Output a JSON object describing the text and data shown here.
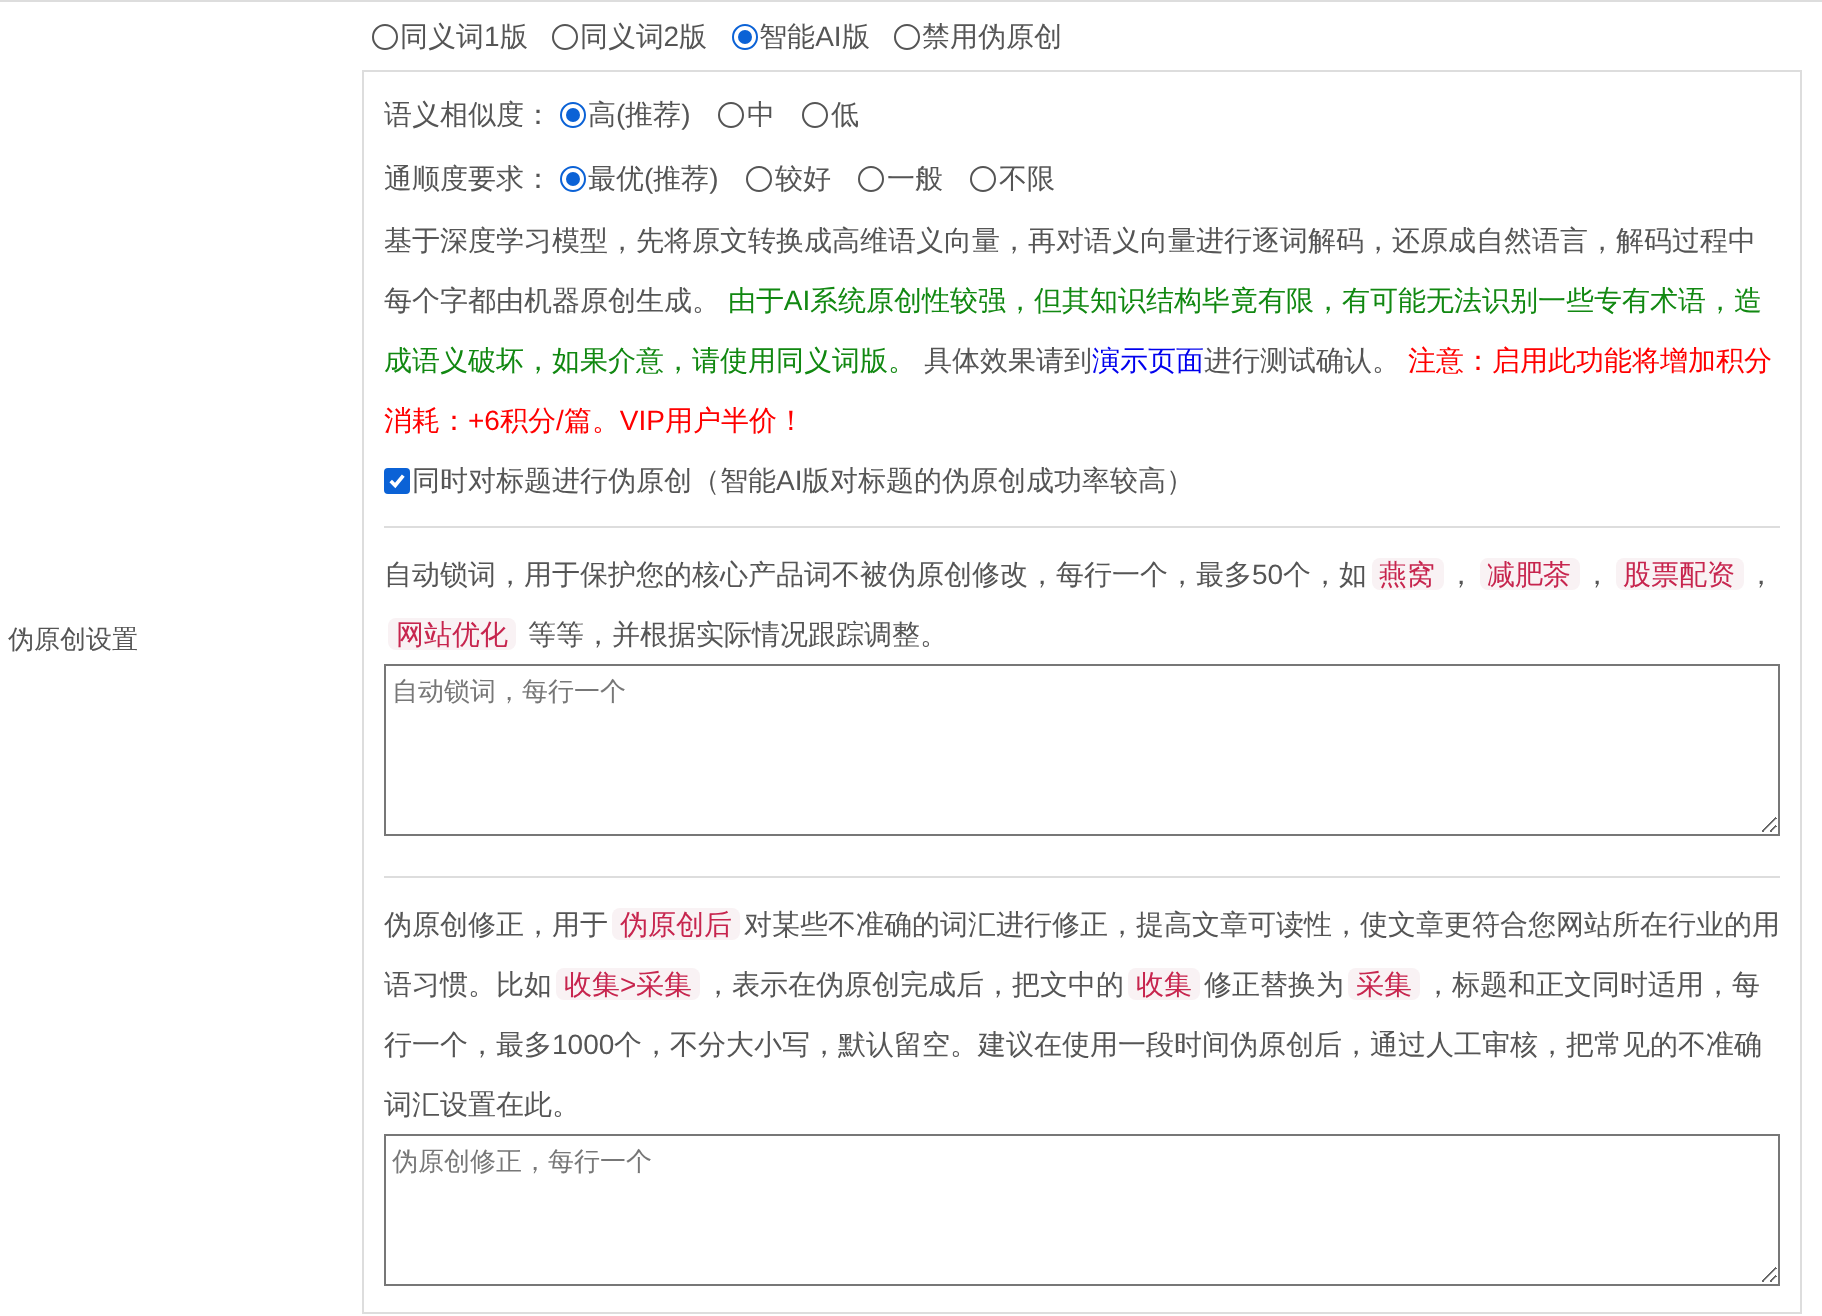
{
  "row_label": "伪原创设置",
  "modes": [
    {
      "label": "同义词1版",
      "selected": false
    },
    {
      "label": "同义词2版",
      "selected": false
    },
    {
      "label": "智能AI版",
      "selected": true
    },
    {
      "label": "禁用伪原创",
      "selected": false
    }
  ],
  "ai_options": [
    {
      "label": "语义相似度：",
      "options": [
        {
          "label": "高(推荐)",
          "selected": true
        },
        {
          "label": "中",
          "selected": false
        },
        {
          "label": "低",
          "selected": false
        }
      ]
    },
    {
      "label": "通顺度要求：",
      "options": [
        {
          "label": "最优(推荐)",
          "selected": true
        },
        {
          "label": "较好",
          "selected": false
        },
        {
          "label": "一般",
          "selected": false
        },
        {
          "label": "不限",
          "selected": false
        }
      ]
    }
  ],
  "ai_description": [
    {
      "kind": "text",
      "text": "基于深度学习模型，先将原文转换成高维语义向量，再对语义向量进行逐词解码，还原成自然语言，解码过程中每个字都由机器原创生成。 "
    },
    {
      "kind": "green",
      "text": "由于AI系统原创性较强，但其知识结构毕竟有限，有可能无法识别一些专有术语，造成语义破坏，如果介意，请使用同义词版。"
    },
    {
      "kind": "text",
      "text": " 具体效果请到"
    },
    {
      "kind": "link",
      "text": "演示页面"
    },
    {
      "kind": "text",
      "text": "进行测试确认。 "
    },
    {
      "kind": "red",
      "text": "注意：启用此功能将增加积分消耗：+6积分/篇。VIP用户半价！"
    }
  ],
  "title_option": {
    "label": "同时对标题进行伪原创（智能AI版对标题的伪原创成功率较高）",
    "checked": true
  },
  "lock_description": [
    {
      "kind": "text",
      "text": "自动锁词，用于保护您的核心产品词不被伪原创修改，每行一个，最多50个，如"
    },
    {
      "kind": "code",
      "text": "燕窝"
    },
    {
      "kind": "text",
      "text": "，"
    },
    {
      "kind": "code",
      "text": "减肥茶"
    },
    {
      "kind": "text",
      "text": "，"
    },
    {
      "kind": "code",
      "text": "股票配资"
    },
    {
      "kind": "text",
      "text": "，"
    },
    {
      "kind": "code",
      "text": "网站优化"
    },
    {
      "kind": "text",
      "text": " 等等，并根据实际情况跟踪调整。"
    }
  ],
  "lock_field": {
    "placeholder": "自动锁词，每行一个"
  },
  "fix_description": [
    {
      "kind": "text",
      "text": "伪原创修正，用于"
    },
    {
      "kind": "code",
      "text": "伪原创后"
    },
    {
      "kind": "text",
      "text": "对某些不准确的词汇进行修正，提高文章可读性，使文章更符合您网站所在行业的用语习惯。比如"
    },
    {
      "kind": "code",
      "text": "收集>采集"
    },
    {
      "kind": "text",
      "text": "，表示在伪原创完成后，把文中的"
    },
    {
      "kind": "code",
      "text": "收集"
    },
    {
      "kind": "text",
      "text": "修正替换为"
    },
    {
      "kind": "code",
      "text": "采集"
    },
    {
      "kind": "text",
      "text": "，标题和正文同时适用，每行一个，最多1000个，不分大小写，默认留空。建议在使用一段时间伪原创后，通过人工审核，把常见的不准确词汇设置在此。"
    }
  ],
  "fix_field": {
    "placeholder": "伪原创修正，每行一个"
  }
}
